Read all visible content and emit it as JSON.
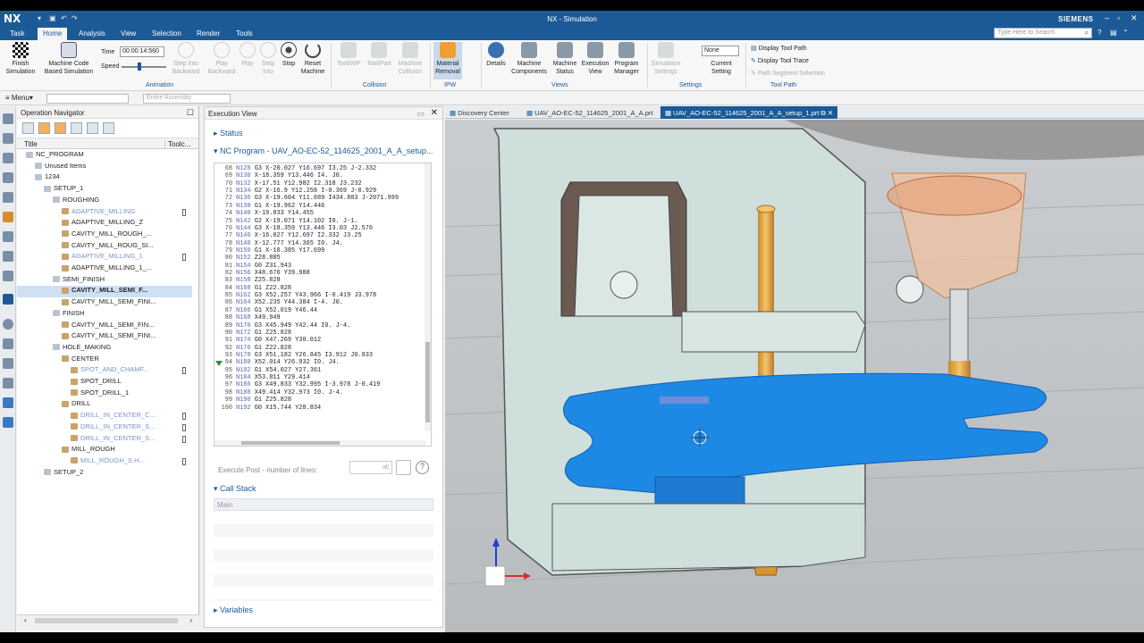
{
  "app": {
    "logo": "NX",
    "window_title": "NX - Simulation",
    "brand": "SIEMENS"
  },
  "menu": {
    "tabs": [
      "Task",
      "Home",
      "Analysis",
      "View",
      "Selection",
      "Render",
      "Tools"
    ],
    "active": "Home",
    "search_placeholder": "Type Here to Search"
  },
  "ribbon": {
    "finish_label": "Finish\nSimulation",
    "machine_code_label": "Machine Code\nBased Simulation",
    "time_label": "Time",
    "time_value": "00:00:14:560",
    "speed_label": "Speed",
    "step_into_back": "Step Into\nBackward",
    "play_back": "Play\nBackward",
    "play": "Play",
    "step_into": "Step\nInto",
    "stop": "Stop",
    "reset": "Reset\nMachine",
    "animation_group": "Animation",
    "toolwp": "Tool/WP",
    "toolpart": "Tool/Part",
    "machine_collision": "Machine\nCollision",
    "collision_group": "Collision",
    "material_removal": "Material\nRemoval",
    "ipw_group": "IPW",
    "details": "Details",
    "machine_components": "Machine\nComponents",
    "machine_status": "Machine\nStatus",
    "execution_view": "Execution\nView",
    "program_manager": "Program\nManager",
    "views_group": "Views",
    "sim_settings": "Simulation\nSettings",
    "none_value": "None",
    "current_setting": "Current\nSetting",
    "settings_group": "Settings",
    "display_tool_path": "Display Tool Path",
    "display_tool_trace": "Display Tool Trace",
    "path_segment_selection": "Path Segment Selection",
    "tool_path_group": "Tool Path"
  },
  "toolbar2": {
    "menu_label": "Menu",
    "filter_value": "",
    "assembly_value": "Entire Assembly"
  },
  "navigator": {
    "title": "Operation Navigator",
    "col_title": "Title",
    "col_tool": "Toolc...",
    "items": [
      {
        "label": "NC_PROGRAM",
        "level": 0,
        "dim": false,
        "hl": false,
        "tool": false
      },
      {
        "label": "Unused Items",
        "level": 1,
        "dim": false,
        "hl": false,
        "tool": false
      },
      {
        "label": "1234",
        "level": 1,
        "dim": false,
        "hl": false,
        "tool": false
      },
      {
        "label": "SETUP_1",
        "level": 2,
        "dim": false,
        "hl": false,
        "tool": false
      },
      {
        "label": "ROUGHING",
        "level": 3,
        "dim": false,
        "hl": false,
        "tool": false
      },
      {
        "label": "ADAPTIVE_MILLING",
        "level": 4,
        "dim": true,
        "hl": false,
        "tool": true
      },
      {
        "label": "ADAPTIVE_MILLING_Z",
        "level": 4,
        "dim": false,
        "hl": false,
        "tool": false
      },
      {
        "label": "CAVITY_MILL_ROUGH_...",
        "level": 4,
        "dim": false,
        "hl": false,
        "tool": false
      },
      {
        "label": "CAVITY_MILL_ROUG_SI...",
        "level": 4,
        "dim": false,
        "hl": false,
        "tool": false
      },
      {
        "label": "ADAPTIVE_MILLING_1",
        "level": 4,
        "dim": true,
        "hl": false,
        "tool": true
      },
      {
        "label": "ADAPTIVE_MILLING_1_...",
        "level": 4,
        "dim": false,
        "hl": false,
        "tool": false
      },
      {
        "label": "SEMI_FINISH",
        "level": 3,
        "dim": false,
        "hl": false,
        "tool": false
      },
      {
        "label": "CAVITY_MILL_SEMI_F...",
        "level": 4,
        "dim": false,
        "hl": true,
        "tool": false
      },
      {
        "label": "CAVITY_MILL_SEMI_FINI...",
        "level": 4,
        "dim": false,
        "hl": false,
        "tool": false
      },
      {
        "label": "FINISH",
        "level": 3,
        "dim": false,
        "hl": false,
        "tool": false
      },
      {
        "label": "CAVITY_MILL_SEMI_FIN...",
        "level": 4,
        "dim": false,
        "hl": false,
        "tool": false
      },
      {
        "label": "CAVITY_MILL_SEMI_FINI...",
        "level": 4,
        "dim": false,
        "hl": false,
        "tool": false
      },
      {
        "label": "HOLE_MAKING",
        "level": 3,
        "dim": false,
        "hl": false,
        "tool": false
      },
      {
        "label": "CENTER",
        "level": 4,
        "dim": false,
        "hl": false,
        "tool": false
      },
      {
        "label": "SPOT_AND_CHAMF...",
        "level": 5,
        "dim": true,
        "hl": false,
        "tool": true
      },
      {
        "label": "SPOT_DRILL",
        "level": 5,
        "dim": false,
        "hl": false,
        "tool": false
      },
      {
        "label": "SPOT_DRILL_1",
        "level": 5,
        "dim": false,
        "hl": false,
        "tool": false
      },
      {
        "label": "DRILL",
        "level": 4,
        "dim": false,
        "hl": false,
        "tool": false
      },
      {
        "label": "DRILL_IN_CENTER_C...",
        "level": 5,
        "dim": true,
        "hl": false,
        "tool": true
      },
      {
        "label": "DRILL_IN_CENTER_S...",
        "level": 5,
        "dim": true,
        "hl": false,
        "tool": true
      },
      {
        "label": "DRILL_IN_CENTER_S...",
        "level": 5,
        "dim": true,
        "hl": false,
        "tool": true
      },
      {
        "label": "MILL_ROUGH",
        "level": 4,
        "dim": false,
        "hl": false,
        "tool": false
      },
      {
        "label": "MILL_ROUGH_S.H...",
        "level": 5,
        "dim": true,
        "hl": false,
        "tool": true
      },
      {
        "label": "SETUP_2",
        "level": 2,
        "dim": false,
        "hl": false,
        "tool": false
      }
    ]
  },
  "exec": {
    "title": "Execution View",
    "status": "Status",
    "nc_program": "NC Program - UAV_AO-EC-52_114625_2001_A_A_setup...",
    "lines": [
      [
        "68",
        "N128",
        "G3 X-20.027 Y16.697 I3.25 J-2.332"
      ],
      [
        "69",
        "N130",
        "X-18.359 Y13.446 I4. J0."
      ],
      [
        "70",
        "N132",
        "X-17.51 Y12.982 I2.318 J3.232"
      ],
      [
        "71",
        "N134",
        "G2 X-16.9 Y12.258 I-0.369 J-0.929"
      ],
      [
        "72",
        "N136",
        "G3 X-19.604 Y11.689 I434.883 J-2071.999"
      ],
      [
        "73",
        "N138",
        "G1 X-19.962 Y14.446"
      ],
      [
        "74",
        "N140",
        "X-19.833 Y14.455"
      ],
      [
        "75",
        "N142",
        "G2 X-19.071 Y14.102 I0. J-1."
      ],
      [
        "76",
        "N144",
        "G3 X-18.359 Y13.446 I3.03 J2.576"
      ],
      [
        "77",
        "N146",
        "X-16.027 Y12.697 I2.332 J3.25"
      ],
      [
        "78",
        "N148",
        "X-12.777 Y14.365 I0. J4."
      ],
      [
        "79",
        "N150",
        "G1 X-10.385 Y17.699"
      ],
      [
        "80",
        "N152",
        "Z28.885"
      ],
      [
        "81",
        "N154",
        "G0 Z31.943"
      ],
      [
        "82",
        "N156",
        "X48.676 Y39.988"
      ],
      [
        "83",
        "N158",
        "Z25.828"
      ],
      [
        "84",
        "N160",
        "G1 Z22.828"
      ],
      [
        "85",
        "N162",
        "G3 X52.257 Y43.966 I-0.419 J3.978"
      ],
      [
        "86",
        "N164",
        "X52.235 Y44.384 I-4. J0."
      ],
      [
        "87",
        "N166",
        "G1 X52.019 Y46.44"
      ],
      [
        "88",
        "N168",
        "X49.949"
      ],
      [
        "89",
        "N170",
        "G3 X45.949 Y42.44 I0. J-4."
      ],
      [
        "90",
        "N172",
        "G1 Z25.828"
      ],
      [
        "91",
        "N174",
        "G0 X47.269 Y30.012"
      ],
      [
        "92",
        "N176",
        "G1 Z22.828"
      ],
      [
        "93",
        "N178",
        "G3 X51.182 Y26.845 I3.912 J0.833"
      ],
      [
        "94",
        "N180",
        "X52.014 Y26.932 I0. J4."
      ],
      [
        "95",
        "N182",
        "G1 X54.027 Y27.361"
      ],
      [
        "96",
        "N184",
        "X53.811 Y29.414"
      ],
      [
        "97",
        "N186",
        "G3 X49.833 Y32.995 I-3.978 J-0.419"
      ],
      [
        "98",
        "N188",
        "X49.414 Y32.973 I0. J-4."
      ],
      [
        "99",
        "N190",
        "G1 Z25.828"
      ],
      [
        "100",
        "N192",
        "G0 X15.744 Y28.834"
      ]
    ],
    "marker_line": 26,
    "execute_post_label": "Execute Post - number of lines:",
    "execute_post_value": "all",
    "call_stack": "Call Stack",
    "call_main": "Main",
    "variables": "Variables"
  },
  "viewport_tabs": [
    {
      "label": "Discovery Center",
      "active": false
    },
    {
      "label": "UAV_AO-EC-52_114625_2001_A_A.prt",
      "active": false
    },
    {
      "label": "UAV_AO-EC-52_114625_2001_A_A_setup_1.prt",
      "active": true
    }
  ],
  "colors": {
    "accent": "#1b5a96",
    "part": "#1e88e5",
    "tool": "#e8a64a",
    "fixture": "#cfe0dc"
  }
}
